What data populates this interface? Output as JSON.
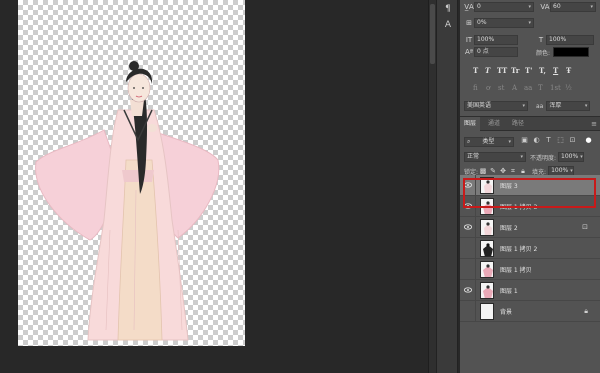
{
  "character_panel": {
    "tracking_value": "0",
    "kerning_value": "60",
    "scale_percent": "0%",
    "vertical_scale": "100%",
    "horizontal_scale": "100%",
    "baseline_shift": "0 点",
    "color_label": "颜色:",
    "color_swatch": "#000000",
    "style_buttons": [
      "T",
      "T",
      "TT",
      "Tr",
      "T'",
      "T,",
      "T",
      "Ŧ"
    ],
    "ligature_buttons": [
      "fi",
      "ơ",
      "st",
      "A",
      "aa",
      "T",
      "1st",
      "½"
    ],
    "language": "美国英语",
    "aa_label": "aa",
    "antialias": "浑厚"
  },
  "layers_panel": {
    "tabs": [
      "图层",
      "通道",
      "路径"
    ],
    "active_tab": "图层",
    "filter_kind": "类型",
    "blend_mode": "正常",
    "opacity_label": "不透明度:",
    "opacity_value": "100%",
    "lock_label": "锁定:",
    "fill_label": "填充:",
    "fill_value": "100%",
    "layers": [
      {
        "name": "图层 3",
        "visible": true,
        "selected": true,
        "thumb": "figure-light"
      },
      {
        "name": "图层 1 拷贝 3",
        "visible": true,
        "selected": false,
        "thumb": "figure-pink"
      },
      {
        "name": "图层 2",
        "visible": true,
        "selected": false,
        "thumb": "figure-light",
        "badge": "smart-object-icon"
      },
      {
        "name": "图层 1 拷贝 2",
        "visible": false,
        "selected": false,
        "thumb": "figure-dark"
      },
      {
        "name": "图层 1 拷贝",
        "visible": false,
        "selected": false,
        "thumb": "figure-pink"
      },
      {
        "name": "图层 1",
        "visible": true,
        "selected": false,
        "thumb": "figure-pink"
      },
      {
        "name": "背景",
        "visible": false,
        "selected": false,
        "thumb": "white",
        "badge": "lock-icon"
      }
    ]
  },
  "colors": {
    "selection_highlight": "#c81a1a",
    "panel_bg": "#535353",
    "workspace_bg": "#282828"
  }
}
